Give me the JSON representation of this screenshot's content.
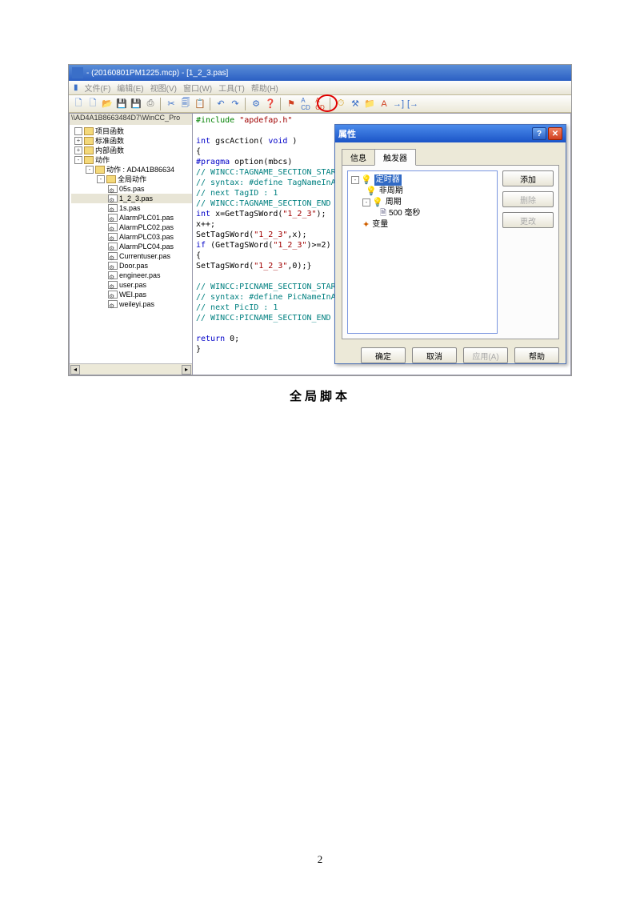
{
  "titlebar": {
    "text": "- (20160801PM1225.mcp) - [1_2_3.pas]"
  },
  "menubar": {
    "items": [
      "文件(F)",
      "编辑(E)",
      "视图(V)",
      "窗口(W)",
      "工具(T)",
      "帮助(H)"
    ]
  },
  "tree": {
    "header": "\\\\AD4A1B8663484D7\\WinCC_Pro",
    "items": [
      {
        "pad": 4,
        "box": "",
        "icon": "ic-folder",
        "label": "项目函数"
      },
      {
        "pad": 4,
        "box": "+",
        "icon": "ic-folder",
        "label": "标准函数"
      },
      {
        "pad": 4,
        "box": "+",
        "icon": "ic-folder",
        "label": "内部函数"
      },
      {
        "pad": 4,
        "box": "-",
        "icon": "ic-folder",
        "label": "动作"
      },
      {
        "pad": 18,
        "box": "-",
        "icon": "ic-folder",
        "label": "动作 : AD4A1B86634"
      },
      {
        "pad": 32,
        "box": "-",
        "icon": "ic-folder",
        "label": "全局动作"
      },
      {
        "pad": 46,
        "box": null,
        "icon": "ic-pas",
        "label": "05s.pas"
      },
      {
        "pad": 46,
        "box": null,
        "icon": "ic-pas",
        "label": "1_2_3.pas",
        "sel": true
      },
      {
        "pad": 46,
        "box": null,
        "icon": "ic-pas",
        "label": "1s.pas"
      },
      {
        "pad": 46,
        "box": null,
        "icon": "ic-pas",
        "label": "AlarmPLC01.pas"
      },
      {
        "pad": 46,
        "box": null,
        "icon": "ic-pas",
        "label": "AlarmPLC02.pas"
      },
      {
        "pad": 46,
        "box": null,
        "icon": "ic-pas",
        "label": "AlarmPLC03.pas"
      },
      {
        "pad": 46,
        "box": null,
        "icon": "ic-pas",
        "label": "AlarmPLC04.pas"
      },
      {
        "pad": 46,
        "box": null,
        "icon": "ic-pas",
        "label": "Currentuser.pas"
      },
      {
        "pad": 46,
        "box": null,
        "icon": "ic-pas",
        "label": "Door.pas"
      },
      {
        "pad": 46,
        "box": null,
        "icon": "ic-pas",
        "label": "engineer.pas"
      },
      {
        "pad": 46,
        "box": null,
        "icon": "ic-pas",
        "label": "user.pas"
      },
      {
        "pad": 46,
        "box": null,
        "icon": "ic-pas",
        "label": "WEI.pas"
      },
      {
        "pad": 46,
        "box": null,
        "icon": "ic-pas",
        "label": "weileyi.pas"
      }
    ]
  },
  "code": {
    "l1a": "#include ",
    "l1b": "\"apdefap.h\"",
    "l2a": "int",
    "l2b": " gscAction( ",
    "l2c": "void",
    "l2d": " )",
    "l3": "{",
    "l4a": "#pragma",
    "l4b": " option(mbcs)",
    "l5": "// WINCC:TAGNAME_SECTION_START",
    "l6": "// syntax: #define TagNameInAction \"DMTagName\"",
    "l7": "// next TagID : 1",
    "l8": "// WINCC:TAGNAME_SECTION_END",
    "l9a": "int",
    "l9b": " x=GetTagSWord(",
    "l9c": "\"1_2_3\"",
    "l9d": ");",
    "l10": "x++;",
    "l11a": "SetTagSWord(",
    "l11b": "\"1_2_3\"",
    "l11c": ",x);",
    "l12a": "if",
    "l12b": " (GetTagSWord(",
    "l12c": "\"1_2_3\"",
    "l12d": ")>=2)",
    "l13": "{",
    "l14a": "SetTagSWord(",
    "l14b": "\"1_2_3\"",
    "l14c": ",0);}",
    "l15": "",
    "l16": "// WINCC:PICNAME_SECTION_START",
    "l17": "// syntax: #define PicNameInAction \"PictureName\"",
    "l18": "// next PicID : 1",
    "l19": "// WINCC:PICNAME_SECTION_END",
    "l20": "",
    "l21a": "return",
    "l21b": " 0;",
    "l22": "}"
  },
  "dialog": {
    "title": "属性",
    "tabs": {
      "info": "信息",
      "trigger": "触发器"
    },
    "tree": {
      "timer": "定时器",
      "acyclic": "非周期",
      "cyclic": "周期",
      "val": "500 毫秒",
      "variable": "变量"
    },
    "side": {
      "add": "添加",
      "del": "删除",
      "mod": "更改"
    },
    "foot": {
      "ok": "确定",
      "cancel": "取消",
      "apply": "应用(A)",
      "help": "帮助"
    }
  },
  "caption": "全局脚本",
  "pagenum": "2"
}
